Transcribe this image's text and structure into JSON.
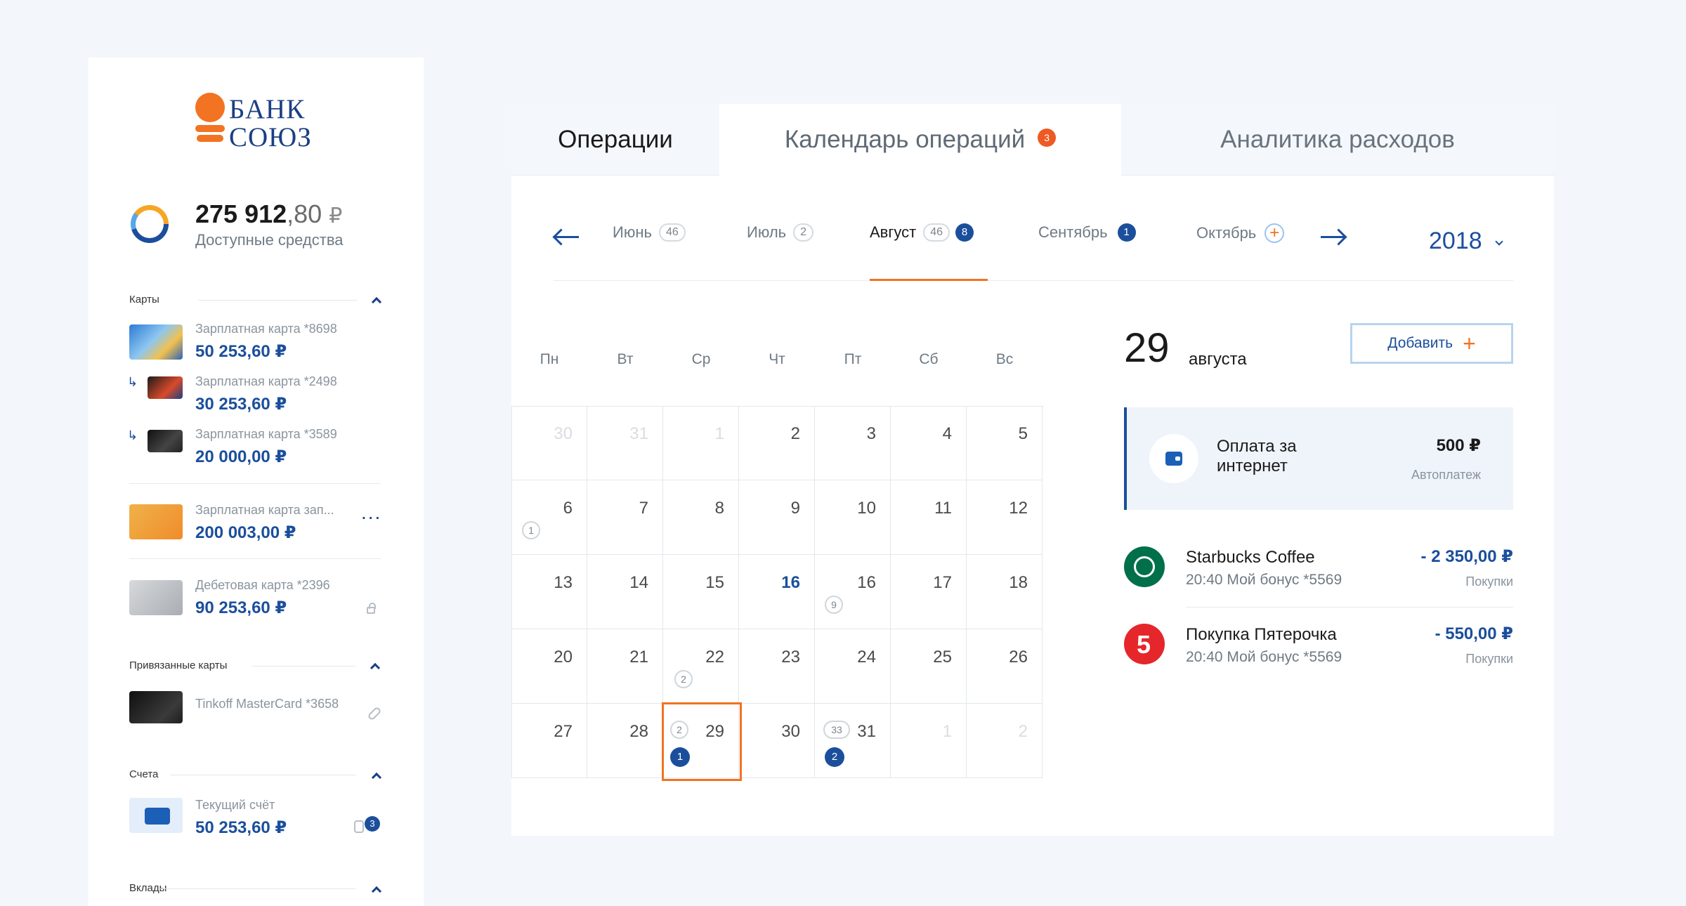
{
  "brand": {
    "line1": "БАНК",
    "line2": "СОЮЗ",
    "color": "#f27321"
  },
  "balance": {
    "main": "275 912",
    "cents": ",80",
    "currency": "₽",
    "label": "Доступные средства"
  },
  "sections": {
    "cards": "Карты",
    "linked": "Привязанные карты",
    "accounts": "Счета",
    "deposits": "Вклады"
  },
  "cards": [
    {
      "name": "Зарплатная карта *8698",
      "amount": "50 253,60 ₽"
    },
    {
      "name": "Зарплатная карта *2498",
      "amount": "30 253,60 ₽"
    },
    {
      "name": "Зарплатная карта *3589",
      "amount": "20 000,00 ₽"
    },
    {
      "name": "Зарплатная карта зап...",
      "amount": "200 003,00 ₽"
    },
    {
      "name": "Дебетовая карта *2396",
      "amount": "90 253,60 ₽"
    }
  ],
  "linked_cards": [
    {
      "name": "Tinkoff MasterCard *3658"
    }
  ],
  "accounts": [
    {
      "name": "Текущий счёт",
      "amount": "50 253,60 ₽",
      "badge": "3"
    }
  ],
  "tabs": {
    "operations": "Операции",
    "calendar": "Календарь операций",
    "calendar_badge": "3",
    "analytics": "Аналитика расходов"
  },
  "months": {
    "june": {
      "label": "Июнь",
      "count": "46"
    },
    "july": {
      "label": "Июль",
      "count": "2"
    },
    "august": {
      "label": "Август",
      "count": "46",
      "badge": "8"
    },
    "september": {
      "label": "Сентябрь",
      "badge": "1"
    },
    "october": {
      "label": "Октябрь"
    }
  },
  "year": "2018",
  "weekdays": [
    "Пн",
    "Вт",
    "Ср",
    "Чт",
    "Пт",
    "Сб",
    "Вс"
  ],
  "calendar": {
    "rows": [
      [
        "30",
        "31",
        "1",
        "2",
        "3",
        "4",
        "5"
      ],
      [
        "6",
        "7",
        "8",
        "9",
        "10",
        "11",
        "12"
      ],
      [
        "13",
        "14",
        "15",
        "16",
        "16",
        "17",
        "18"
      ],
      [
        "20",
        "21",
        "22",
        "23",
        "24",
        "25",
        "26"
      ],
      [
        "27",
        "28",
        "29",
        "30",
        "31",
        "1",
        "2"
      ]
    ],
    "markers": {
      "r1c0": "1",
      "r2c4": "9",
      "r3c2": "2",
      "r4c2_ring": "2",
      "r4c2_solid": "1",
      "r4c4_ring": "33",
      "r4c4_solid": "2"
    }
  },
  "detail": {
    "day": "29",
    "month": "августа",
    "add_label": "Добавить",
    "autopay": {
      "title": "Оплата за интернет",
      "amount": "500 ₽",
      "sub": "Автоплатеж"
    },
    "transactions": [
      {
        "name": "Starbucks Coffee",
        "sub": "20:40 Мой бонус *5569",
        "amount": "- 2 350,00 ₽",
        "category": "Покупки"
      },
      {
        "name": "Покупка Пятерочка",
        "sub": "20:40 Мой бонус *5569",
        "amount": "- 550,00 ₽",
        "category": "Покупки"
      }
    ]
  },
  "colors": {
    "accent": "#f27321",
    "primary": "#1b4f9c",
    "background": "#f3f7fb"
  },
  "icons": {
    "add": "+",
    "more": "...",
    "plus": "+"
  }
}
